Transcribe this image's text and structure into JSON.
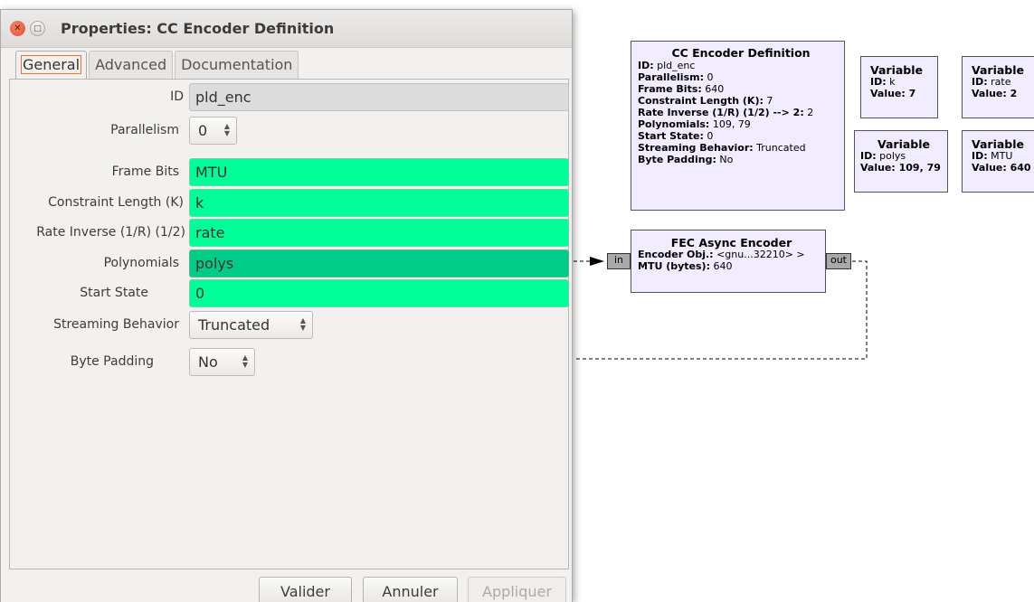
{
  "dialog": {
    "title": "Properties: CC Encoder Definition",
    "tabs": [
      "General",
      "Advanced",
      "Documentation"
    ],
    "fields": {
      "id": {
        "label": "ID",
        "value": "pld_enc"
      },
      "parallelism": {
        "label": "Parallelism",
        "value": "0"
      },
      "frame_bits": {
        "label": "Frame Bits",
        "value": "MTU"
      },
      "constraint_length": {
        "label": "Constraint Length (K)",
        "value": "k"
      },
      "rate_inverse": {
        "label": "Rate Inverse (1/R) (1/2)",
        "value": "rate"
      },
      "polynomials": {
        "label": "Polynomials",
        "value": "polys"
      },
      "start_state": {
        "label": "Start State",
        "value": "0"
      },
      "streaming_behavior": {
        "label": "Streaming Behavior",
        "value": "Truncated"
      },
      "byte_padding": {
        "label": "Byte Padding",
        "value": "No"
      }
    },
    "buttons": {
      "ok": "Valider",
      "cancel": "Annuler",
      "apply": "Appliquer"
    },
    "colors": {
      "param_bg": "#00ff99",
      "param_selected_bg": "#00cc88",
      "id_bg": "#dcdcdc"
    }
  },
  "flowgraph": {
    "cc_encoder_block": {
      "title": "CC Encoder Definition",
      "lines": [
        {
          "key": "ID:",
          "val": " pld_enc"
        },
        {
          "key": "Parallelism:",
          "val": " 0"
        },
        {
          "key": "Frame Bits:",
          "val": " 640"
        },
        {
          "key": "Constraint Length (K):",
          "val": " 7"
        },
        {
          "key": "Rate Inverse (1/R) (1/2) --> 2:",
          "val": " 2"
        },
        {
          "key": "Polynomials:",
          "val": " 109, 79"
        },
        {
          "key": "Start State:",
          "val": " 0"
        },
        {
          "key": "Streaming Behavior:",
          "val": " Truncated"
        },
        {
          "key": "Byte Padding:",
          "val": " No"
        }
      ]
    },
    "variables": [
      {
        "title": "Variable",
        "id_key": "ID:",
        "id": " k",
        "value_key": "Value:",
        "value": " 7"
      },
      {
        "title": "Variable",
        "id_key": "ID:",
        "id": " rate",
        "value_key": "Value:",
        "value": " 2"
      },
      {
        "title": "Variable",
        "id_key": "ID:",
        "id": " polys",
        "value_key": "Value:",
        "value": " 109, 79"
      },
      {
        "title": "Variable",
        "id_key": "ID:",
        "id": " MTU",
        "value_key": "Value:",
        "value": " 640"
      }
    ],
    "fec_block": {
      "title": "FEC Async Encoder",
      "lines": [
        {
          "key": "Encoder Obj.:",
          "val": " <gnu...32210> >"
        },
        {
          "key": "MTU (bytes):",
          "val": " 640"
        }
      ],
      "port_in": "in",
      "port_out": "out"
    },
    "block_color": "#f1ecff"
  }
}
